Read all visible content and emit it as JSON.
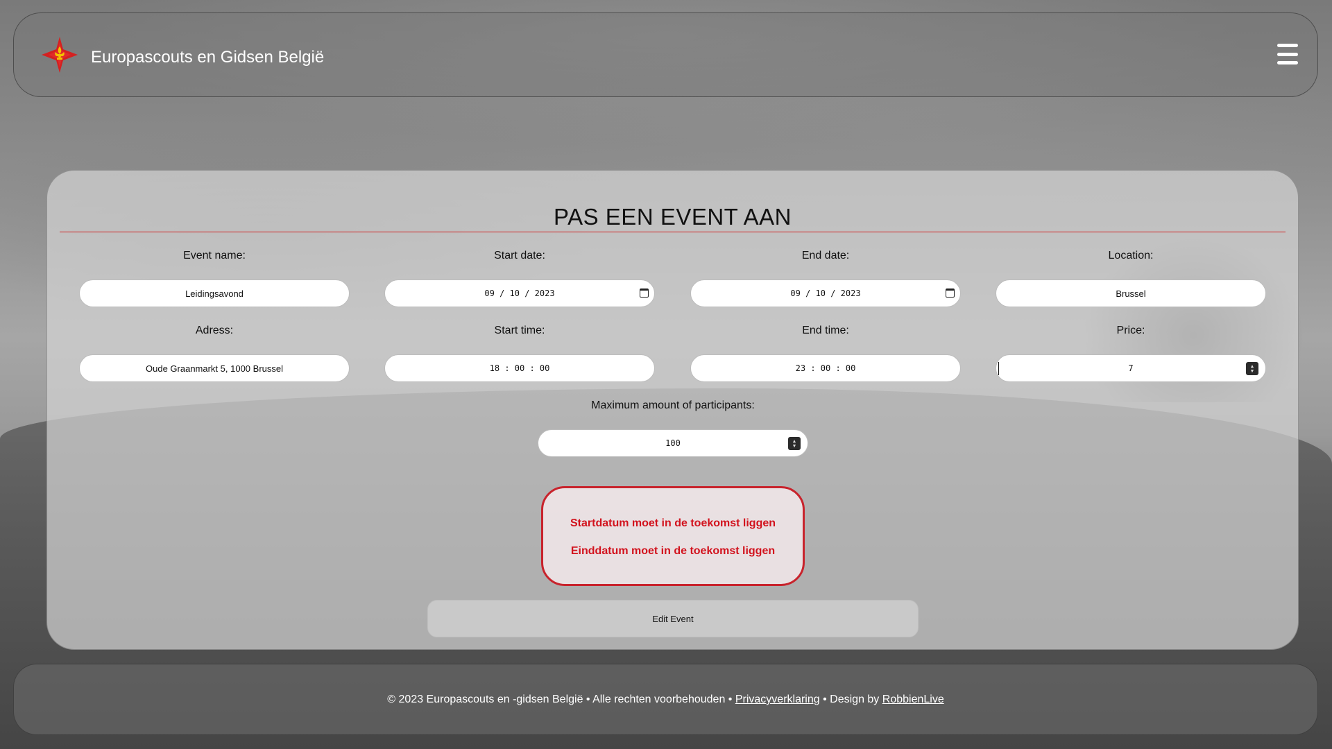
{
  "header": {
    "brand": "Europascouts en Gidsen België"
  },
  "form": {
    "title": "PAS EEN EVENT AAN",
    "event_name": {
      "label": "Event name:",
      "value": "Leidingsavond"
    },
    "start_date": {
      "label": "Start date:",
      "value": "09 / 10 / 2023"
    },
    "end_date": {
      "label": "End date:",
      "value": "09 / 10 / 2023"
    },
    "location": {
      "label": "Location:",
      "value": "Brussel"
    },
    "address": {
      "label": "Adress:",
      "value": "Oude Graanmarkt 5, 1000 Brussel"
    },
    "start_time": {
      "label": "Start time:",
      "value": "18 : 00 : 00"
    },
    "end_time": {
      "label": "End time:",
      "value": "23 : 00 : 00"
    },
    "price": {
      "label": "Price:",
      "value": "7"
    },
    "max_participants": {
      "label": "Maximum amount of participants:",
      "value": "100"
    },
    "errors": [
      "Startdatum moet in de toekomst liggen",
      "Einddatum moet in de toekomst liggen"
    ],
    "submit_label": "Edit Event"
  },
  "footer": {
    "copyright": "© 2023 Europascouts en -gidsen België • Alle rechten voorbehouden •",
    "privacy_link": "Privacyverklaring",
    "design_by": "• Design by",
    "designer_link": "RobbienLive"
  },
  "colors": {
    "accent_red": "#d2121d",
    "rule_red": "#d21f1f"
  }
}
